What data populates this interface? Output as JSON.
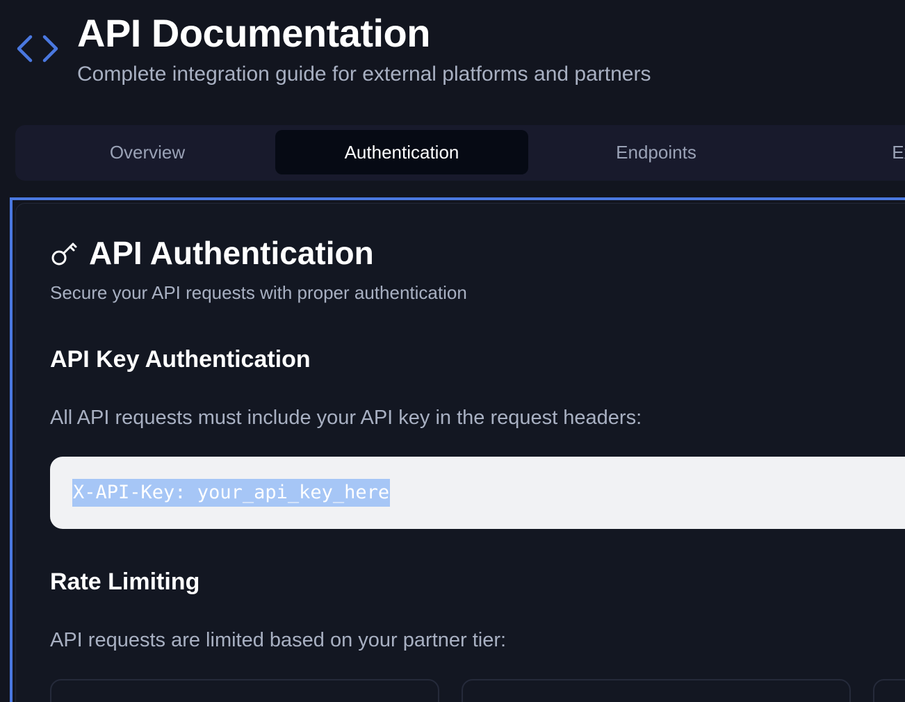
{
  "header": {
    "icon": "code-brackets-icon",
    "title": "API Documentation",
    "subtitle": "Complete integration guide for external platforms and partners"
  },
  "tabs": [
    {
      "label": "Overview",
      "active": false
    },
    {
      "label": "Authentication",
      "active": true
    },
    {
      "label": "Endpoints",
      "active": false
    },
    {
      "label": "Exar",
      "active": false
    }
  ],
  "auth": {
    "icon": "key-icon",
    "title": "API Authentication",
    "description": "Secure your API requests with proper authentication",
    "api_key": {
      "heading": "API Key Authentication",
      "text": "All API requests must include your API key in the request headers:",
      "code": "X-API-Key: your_api_key_here"
    },
    "rate_limit": {
      "heading": "Rate Limiting",
      "text": "API requests are limited based on your partner tier:"
    }
  },
  "colors": {
    "background": "#12151f",
    "accent": "#4a78e0",
    "tab_bar": "#181a2c",
    "tab_active": "#060a14",
    "muted_text": "#a8b0c2",
    "code_bg": "#f1f2f4",
    "selection": "#a6c6f6"
  }
}
